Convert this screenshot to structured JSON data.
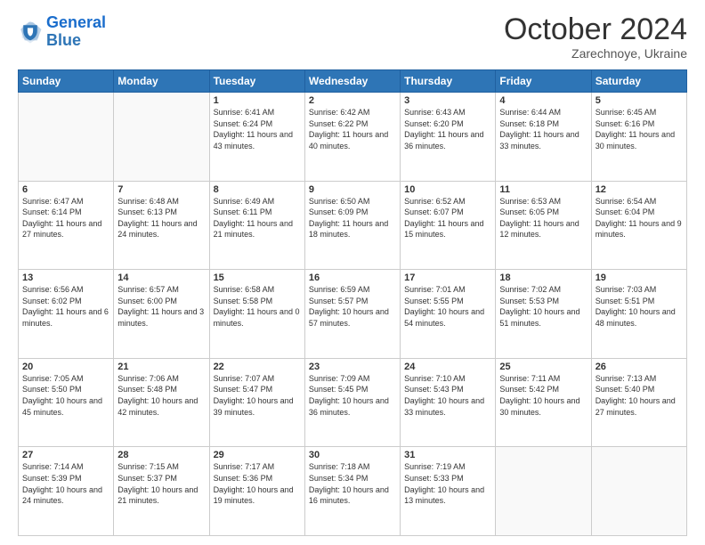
{
  "header": {
    "logo_line1": "General",
    "logo_line2": "Blue",
    "month": "October 2024",
    "location": "Zarechnoye, Ukraine"
  },
  "days_of_week": [
    "Sunday",
    "Monday",
    "Tuesday",
    "Wednesday",
    "Thursday",
    "Friday",
    "Saturday"
  ],
  "weeks": [
    [
      {
        "day": "",
        "sunrise": "",
        "sunset": "",
        "daylight": ""
      },
      {
        "day": "",
        "sunrise": "",
        "sunset": "",
        "daylight": ""
      },
      {
        "day": "1",
        "sunrise": "Sunrise: 6:41 AM",
        "sunset": "Sunset: 6:24 PM",
        "daylight": "Daylight: 11 hours and 43 minutes."
      },
      {
        "day": "2",
        "sunrise": "Sunrise: 6:42 AM",
        "sunset": "Sunset: 6:22 PM",
        "daylight": "Daylight: 11 hours and 40 minutes."
      },
      {
        "day": "3",
        "sunrise": "Sunrise: 6:43 AM",
        "sunset": "Sunset: 6:20 PM",
        "daylight": "Daylight: 11 hours and 36 minutes."
      },
      {
        "day": "4",
        "sunrise": "Sunrise: 6:44 AM",
        "sunset": "Sunset: 6:18 PM",
        "daylight": "Daylight: 11 hours and 33 minutes."
      },
      {
        "day": "5",
        "sunrise": "Sunrise: 6:45 AM",
        "sunset": "Sunset: 6:16 PM",
        "daylight": "Daylight: 11 hours and 30 minutes."
      }
    ],
    [
      {
        "day": "6",
        "sunrise": "Sunrise: 6:47 AM",
        "sunset": "Sunset: 6:14 PM",
        "daylight": "Daylight: 11 hours and 27 minutes."
      },
      {
        "day": "7",
        "sunrise": "Sunrise: 6:48 AM",
        "sunset": "Sunset: 6:13 PM",
        "daylight": "Daylight: 11 hours and 24 minutes."
      },
      {
        "day": "8",
        "sunrise": "Sunrise: 6:49 AM",
        "sunset": "Sunset: 6:11 PM",
        "daylight": "Daylight: 11 hours and 21 minutes."
      },
      {
        "day": "9",
        "sunrise": "Sunrise: 6:50 AM",
        "sunset": "Sunset: 6:09 PM",
        "daylight": "Daylight: 11 hours and 18 minutes."
      },
      {
        "day": "10",
        "sunrise": "Sunrise: 6:52 AM",
        "sunset": "Sunset: 6:07 PM",
        "daylight": "Daylight: 11 hours and 15 minutes."
      },
      {
        "day": "11",
        "sunrise": "Sunrise: 6:53 AM",
        "sunset": "Sunset: 6:05 PM",
        "daylight": "Daylight: 11 hours and 12 minutes."
      },
      {
        "day": "12",
        "sunrise": "Sunrise: 6:54 AM",
        "sunset": "Sunset: 6:04 PM",
        "daylight": "Daylight: 11 hours and 9 minutes."
      }
    ],
    [
      {
        "day": "13",
        "sunrise": "Sunrise: 6:56 AM",
        "sunset": "Sunset: 6:02 PM",
        "daylight": "Daylight: 11 hours and 6 minutes."
      },
      {
        "day": "14",
        "sunrise": "Sunrise: 6:57 AM",
        "sunset": "Sunset: 6:00 PM",
        "daylight": "Daylight: 11 hours and 3 minutes."
      },
      {
        "day": "15",
        "sunrise": "Sunrise: 6:58 AM",
        "sunset": "Sunset: 5:58 PM",
        "daylight": "Daylight: 11 hours and 0 minutes."
      },
      {
        "day": "16",
        "sunrise": "Sunrise: 6:59 AM",
        "sunset": "Sunset: 5:57 PM",
        "daylight": "Daylight: 10 hours and 57 minutes."
      },
      {
        "day": "17",
        "sunrise": "Sunrise: 7:01 AM",
        "sunset": "Sunset: 5:55 PM",
        "daylight": "Daylight: 10 hours and 54 minutes."
      },
      {
        "day": "18",
        "sunrise": "Sunrise: 7:02 AM",
        "sunset": "Sunset: 5:53 PM",
        "daylight": "Daylight: 10 hours and 51 minutes."
      },
      {
        "day": "19",
        "sunrise": "Sunrise: 7:03 AM",
        "sunset": "Sunset: 5:51 PM",
        "daylight": "Daylight: 10 hours and 48 minutes."
      }
    ],
    [
      {
        "day": "20",
        "sunrise": "Sunrise: 7:05 AM",
        "sunset": "Sunset: 5:50 PM",
        "daylight": "Daylight: 10 hours and 45 minutes."
      },
      {
        "day": "21",
        "sunrise": "Sunrise: 7:06 AM",
        "sunset": "Sunset: 5:48 PM",
        "daylight": "Daylight: 10 hours and 42 minutes."
      },
      {
        "day": "22",
        "sunrise": "Sunrise: 7:07 AM",
        "sunset": "Sunset: 5:47 PM",
        "daylight": "Daylight: 10 hours and 39 minutes."
      },
      {
        "day": "23",
        "sunrise": "Sunrise: 7:09 AM",
        "sunset": "Sunset: 5:45 PM",
        "daylight": "Daylight: 10 hours and 36 minutes."
      },
      {
        "day": "24",
        "sunrise": "Sunrise: 7:10 AM",
        "sunset": "Sunset: 5:43 PM",
        "daylight": "Daylight: 10 hours and 33 minutes."
      },
      {
        "day": "25",
        "sunrise": "Sunrise: 7:11 AM",
        "sunset": "Sunset: 5:42 PM",
        "daylight": "Daylight: 10 hours and 30 minutes."
      },
      {
        "day": "26",
        "sunrise": "Sunrise: 7:13 AM",
        "sunset": "Sunset: 5:40 PM",
        "daylight": "Daylight: 10 hours and 27 minutes."
      }
    ],
    [
      {
        "day": "27",
        "sunrise": "Sunrise: 7:14 AM",
        "sunset": "Sunset: 5:39 PM",
        "daylight": "Daylight: 10 hours and 24 minutes."
      },
      {
        "day": "28",
        "sunrise": "Sunrise: 7:15 AM",
        "sunset": "Sunset: 5:37 PM",
        "daylight": "Daylight: 10 hours and 21 minutes."
      },
      {
        "day": "29",
        "sunrise": "Sunrise: 7:17 AM",
        "sunset": "Sunset: 5:36 PM",
        "daylight": "Daylight: 10 hours and 19 minutes."
      },
      {
        "day": "30",
        "sunrise": "Sunrise: 7:18 AM",
        "sunset": "Sunset: 5:34 PM",
        "daylight": "Daylight: 10 hours and 16 minutes."
      },
      {
        "day": "31",
        "sunrise": "Sunrise: 7:19 AM",
        "sunset": "Sunset: 5:33 PM",
        "daylight": "Daylight: 10 hours and 13 minutes."
      },
      {
        "day": "",
        "sunrise": "",
        "sunset": "",
        "daylight": ""
      },
      {
        "day": "",
        "sunrise": "",
        "sunset": "",
        "daylight": ""
      }
    ]
  ]
}
